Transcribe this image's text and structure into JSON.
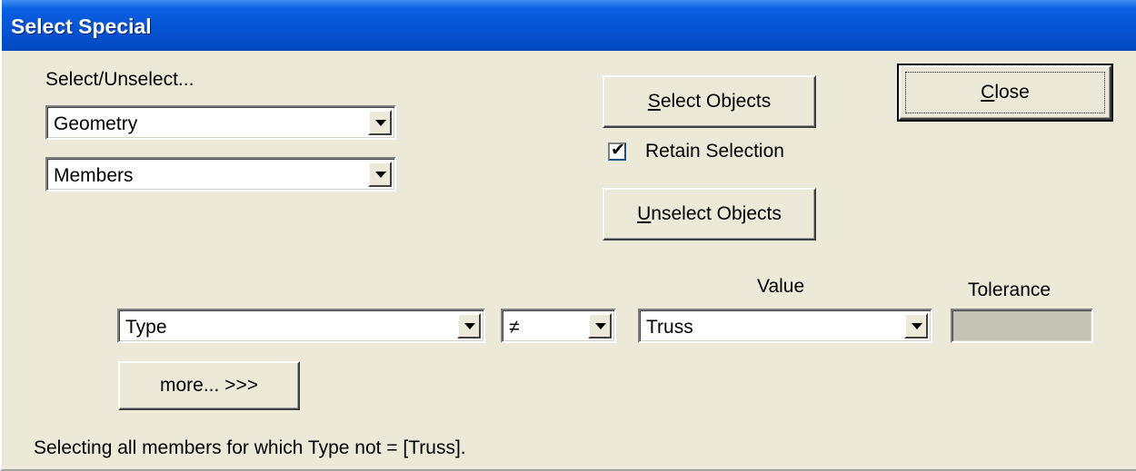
{
  "window": {
    "title": "Select Special"
  },
  "select_group": {
    "label": "Select/Unselect...",
    "category_value": "Geometry",
    "object_value": "Members"
  },
  "actions": {
    "select_label_mnemonic": "S",
    "select_label_rest": "elect Objects",
    "retain_selection_label": "Retain Selection",
    "retain_selection_checked": true,
    "unselect_label_mnemonic": "U",
    "unselect_label_rest": "nselect Objects",
    "close_label_mnemonic": "C",
    "close_label_rest": "lose"
  },
  "criteria": {
    "value_header": "Value",
    "tolerance_header": "Tolerance",
    "property_value": "Type",
    "operator_value": "≠",
    "value_value": "Truss",
    "tolerance_value": "",
    "more_label": "more... >>>"
  },
  "status": {
    "message": "Selecting all members for which Type not = [Truss]."
  },
  "colors": {
    "titlebar": "#0653d4",
    "face": "#ece9d8",
    "disabled_field": "#c3c3b4"
  },
  "icons": {
    "dropdown": "chevron-down-icon",
    "checkmark": "check-icon"
  }
}
